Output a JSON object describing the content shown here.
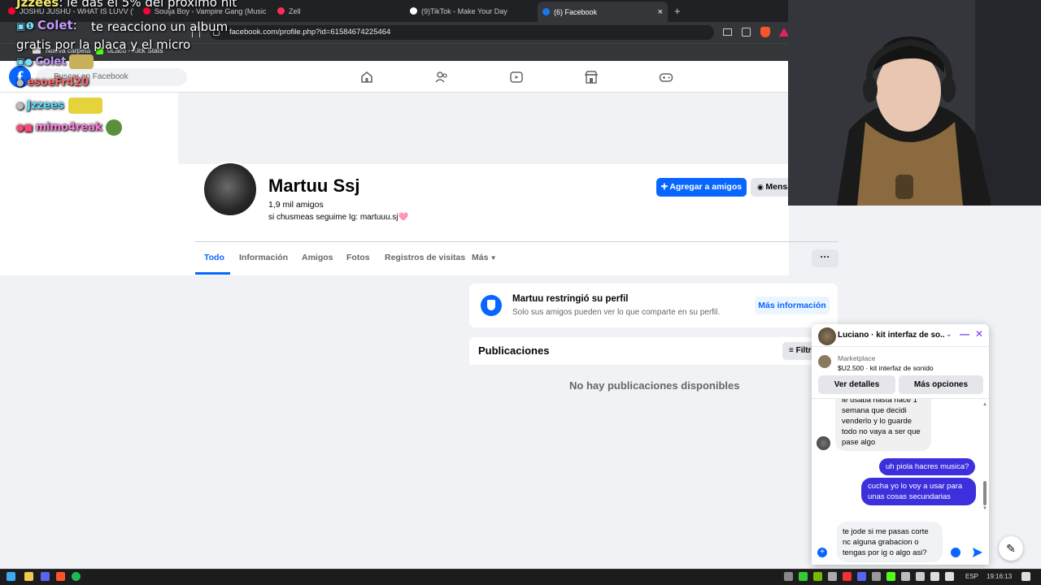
{
  "browser": {
    "tabs": [
      {
        "label": "JOSHU JUSHU - WHAT IS LUVV (Vid",
        "color": "#ff0033"
      },
      {
        "label": "Soulja Boy - Vampire Gang (Music Vi",
        "color": "#ff0033"
      },
      {
        "label": "Zell",
        "color": "#ff2d55"
      },
      {
        "label": "(9)TikTok - Make Your Day",
        "color": "#ffffff"
      },
      {
        "label": "(6) Facebook",
        "color": "#1877f2"
      }
    ],
    "new_tab": "+",
    "close_tab": "×",
    "url": "facebook.com/profile.php?id=61584674225464",
    "bookmarks": [
      "Nueva carpeta",
      "0Laco - Kick Stats"
    ]
  },
  "facebook": {
    "logo": "f",
    "search_placeholder": "Buscar en Facebook",
    "nav_icons": [
      "home-icon",
      "friends-icon",
      "video-icon",
      "marketplace-icon",
      "gaming-icon"
    ]
  },
  "stream_chat": [
    {
      "name": "Jzzees",
      "text": "le das el 5% del proximo hit"
    },
    {
      "name": "Colet",
      "text": "te reacciono un album gratis por la placa y el micro"
    },
    {
      "name": "Colet",
      "text": ""
    },
    {
      "name": "esoeFr420",
      "text": ""
    },
    {
      "name": "Jzzees",
      "text": ""
    },
    {
      "name": "mimo4reak",
      "text": ""
    }
  ],
  "profile": {
    "name": "Martuu Ssj",
    "friends": "1,9 mil amigos",
    "bio": "si chusmeas seguime Ig: martuuu.sj🩷",
    "add_friend": "Agregar a amigos",
    "message": "Mensaje",
    "tabs": [
      "Todo",
      "Información",
      "Amigos",
      "Fotos",
      "Registros de visitas",
      "Más"
    ],
    "more_options": "···"
  },
  "restricted": {
    "title": "Martuu restringió su perfil",
    "subtitle": "Solo sus amigos pueden ver lo que comparte en su perfil.",
    "more_info": "Más información"
  },
  "posts": {
    "title": "Publicaciones",
    "filter": "Filtros",
    "empty": "No hay publicaciones disponibles"
  },
  "messenger": {
    "title": "Luciano · kit interfaz de so...",
    "marketplace_label": "Marketplace",
    "listing": "$U2.500 · kit interfaz de sonido",
    "details_btn": "Ver detalles",
    "more_btn": "Más opciones",
    "messages": [
      {
        "from": "them",
        "text": "le usaba hasta hace 1 semana que decidi venderlo y lo guarde todo no vaya a ser que pase algo"
      },
      {
        "from": "me",
        "text": "uh piola hacres musica?"
      },
      {
        "from": "me",
        "text": "cucha yo lo voy a usar para unas cosas secundarias"
      }
    ],
    "draft": "te jode si me pasas corte nc alguna grabacion o tengas por ig o algo asi?"
  },
  "taskbar": {
    "language": "ESP",
    "time": "19:16:13"
  },
  "colors": {
    "fb_blue": "#0866ff",
    "messenger_purple": "#3d2fdc"
  }
}
